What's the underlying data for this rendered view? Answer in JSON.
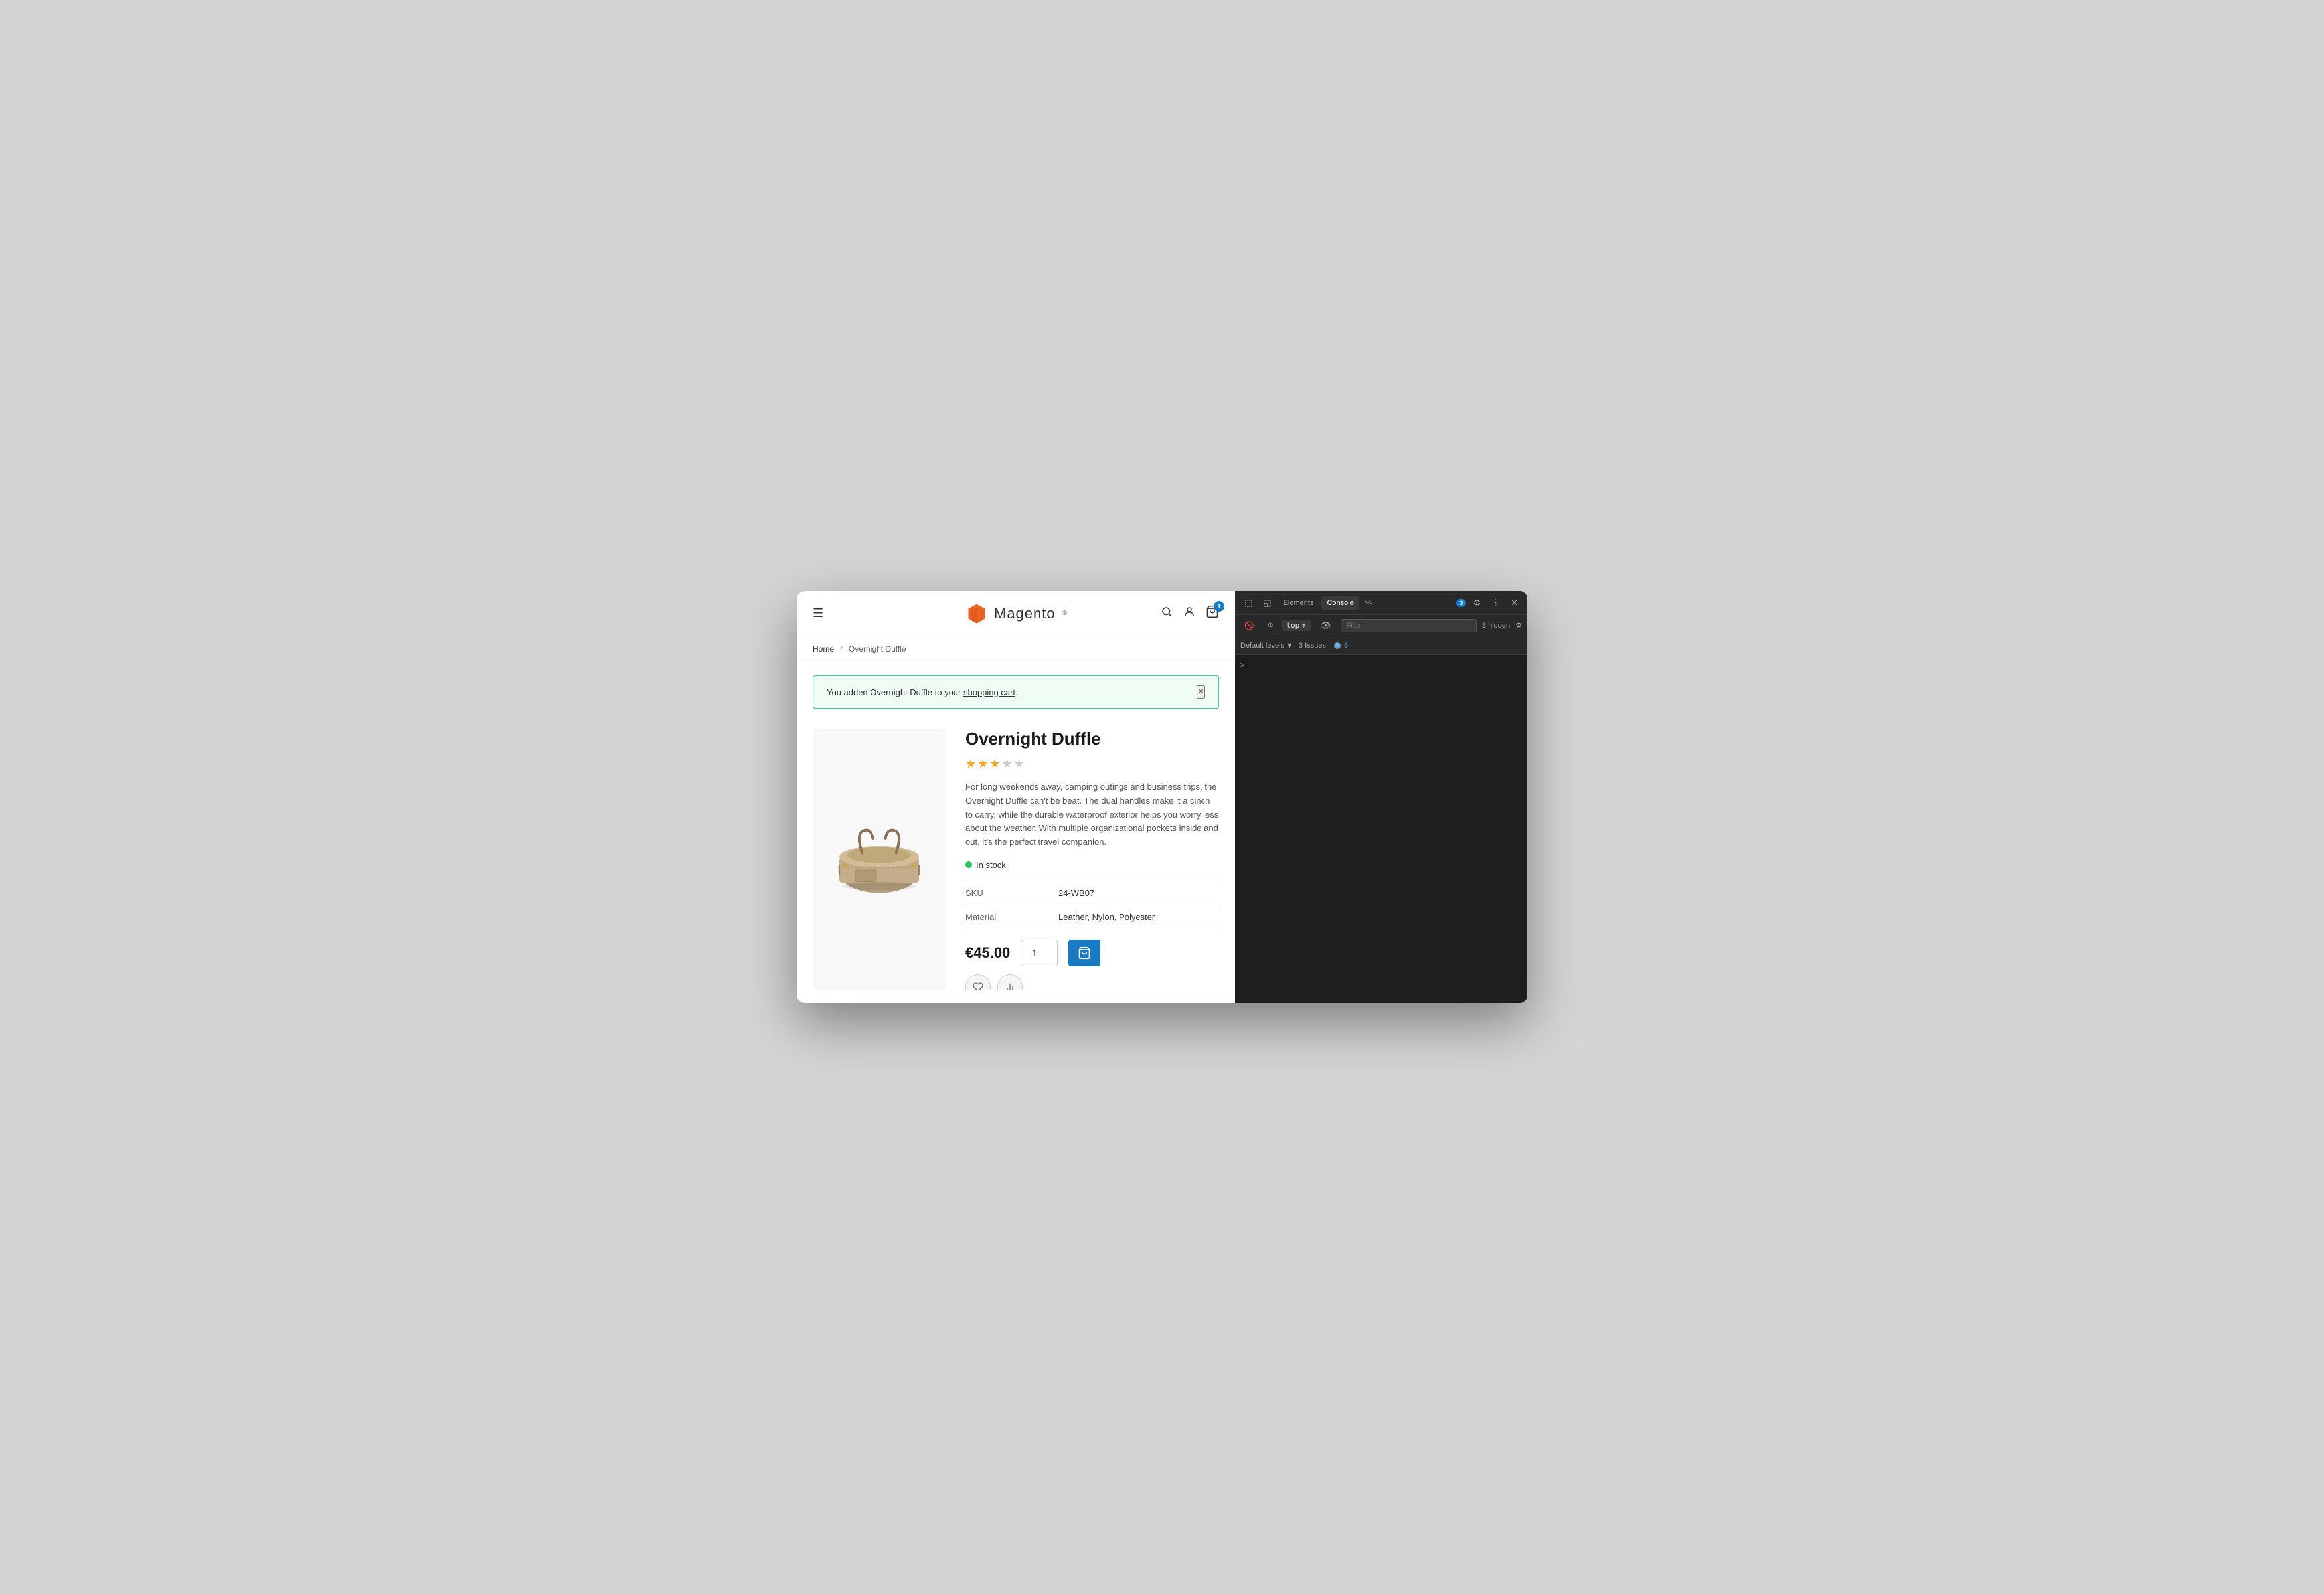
{
  "window": {
    "bg_color": "#d4d4d4"
  },
  "header": {
    "hamburger_label": "☰",
    "logo_text": "Magento",
    "cart_count": "1"
  },
  "breadcrumb": {
    "home_label": "Home",
    "separator": "/",
    "current": "Overnight Duffle"
  },
  "notification": {
    "text_prefix": "You added Overnight Duffle to your ",
    "link_text": "shopping cart",
    "text_suffix": ".",
    "close_label": "×"
  },
  "product": {
    "title": "Overnight Duffle",
    "description": "For long weekends away, camping outings and business trips, the Overnight Duffle can't be beat. The dual handles make it a cinch to carry, while the durable waterproof exterior helps you worry less about the weather. With multiple organizational pockets inside and out, it's the perfect travel companion.",
    "stock_label": "In stock",
    "sku_label": "SKU",
    "sku_value": "24-WB07",
    "material_label": "Material",
    "material_value": "Leather, Nylon, Polyester",
    "price": "€45.00",
    "qty_value": "1",
    "stars": {
      "filled": 2.5,
      "total": 5
    }
  },
  "devtools": {
    "tabs": [
      {
        "label": "Elements",
        "active": false
      },
      {
        "label": "Console",
        "active": true
      },
      {
        "label": ">>",
        "active": false
      }
    ],
    "badge_count": "3",
    "top_label": "top",
    "filter_placeholder": "Filter",
    "hidden_label": "3 hidden",
    "levels_label": "Default levels",
    "issues_label": "3 Issues:",
    "issues_count": "3",
    "caret": ">"
  }
}
